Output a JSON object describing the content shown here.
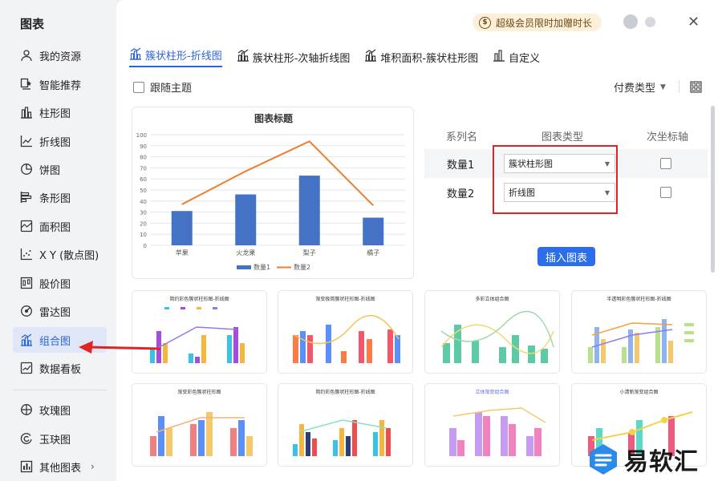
{
  "sidebar": {
    "title": "图表",
    "items": [
      {
        "label": "我的资源",
        "icon": "user-icon"
      },
      {
        "label": "智能推荐",
        "icon": "smart-recommend-icon"
      },
      {
        "label": "柱形图",
        "icon": "bar-chart-icon"
      },
      {
        "label": "折线图",
        "icon": "line-chart-icon"
      },
      {
        "label": "饼图",
        "icon": "pie-chart-icon"
      },
      {
        "label": "条形图",
        "icon": "horizontal-bar-icon"
      },
      {
        "label": "面积图",
        "icon": "area-chart-icon"
      },
      {
        "label": "X Y (散点图)",
        "icon": "scatter-icon"
      },
      {
        "label": "股价图",
        "icon": "stock-chart-icon"
      },
      {
        "label": "雷达图",
        "icon": "radar-chart-icon"
      },
      {
        "label": "组合图",
        "icon": "combo-chart-icon",
        "active": true
      },
      {
        "label": "数据看板",
        "icon": "dashboard-icon"
      },
      {
        "label": "玫瑰图",
        "icon": "rose-chart-icon"
      },
      {
        "label": "玉玦图",
        "icon": "ring-chart-icon"
      },
      {
        "label": "其他图表",
        "icon": "other-chart-icon"
      }
    ]
  },
  "header": {
    "vip_label": "超级会员限时加赠时长",
    "coin_glyph": "$"
  },
  "tabs": [
    {
      "label": "簇状柱形-折线图",
      "active": true
    },
    {
      "label": "簇状柱形-次轴折线图"
    },
    {
      "label": "堆积面积-簇状柱形图"
    },
    {
      "label": "自定义"
    }
  ],
  "toolbar": {
    "follow_theme_label": "跟随主题",
    "pay_type_label": "付费类型"
  },
  "config": {
    "col_series": "系列名",
    "col_type": "图表类型",
    "col_axis": "次坐标轴",
    "rows": [
      {
        "name": "数量1",
        "type": "簇状柱形图"
      },
      {
        "name": "数量2",
        "type": "折线图"
      }
    ],
    "insert_label": "插入图表"
  },
  "chart_data": {
    "type": "bar",
    "title": "图表标题",
    "categories": [
      "苹果",
      "火龙果",
      "梨子",
      "橘子"
    ],
    "series": [
      {
        "name": "数量1",
        "type": "bar",
        "values": [
          31,
          46,
          63,
          25
        ]
      },
      {
        "name": "数量2",
        "type": "line",
        "values": [
          37,
          67,
          94,
          36
        ]
      }
    ],
    "ylim": [
      0,
      100
    ],
    "yticks": [
      0,
      10,
      20,
      30,
      40,
      50,
      60,
      70,
      80,
      90,
      100
    ],
    "legend": "bottom",
    "colors": {
      "bar": "#4472c4",
      "line": "#ed7d31"
    }
  },
  "thumbnails": [
    {
      "title": "简约彩色簇状柱形图-折线图"
    },
    {
      "title": "渐变极简簇状柱形图-折线图"
    },
    {
      "title": "多彩立体组合图"
    },
    {
      "title": "半透明彩色簇状柱形图-折线图"
    },
    {
      "title": "渐变彩色簇状柱形图"
    },
    {
      "title": "简约彩色簇状柱形图-折线图"
    },
    {
      "title": "立体渐变组合图"
    },
    {
      "title": "小清新渐变组合图"
    }
  ],
  "watermark": {
    "text": "易软汇"
  },
  "annotation": {
    "arrow_color": "#e02424"
  }
}
